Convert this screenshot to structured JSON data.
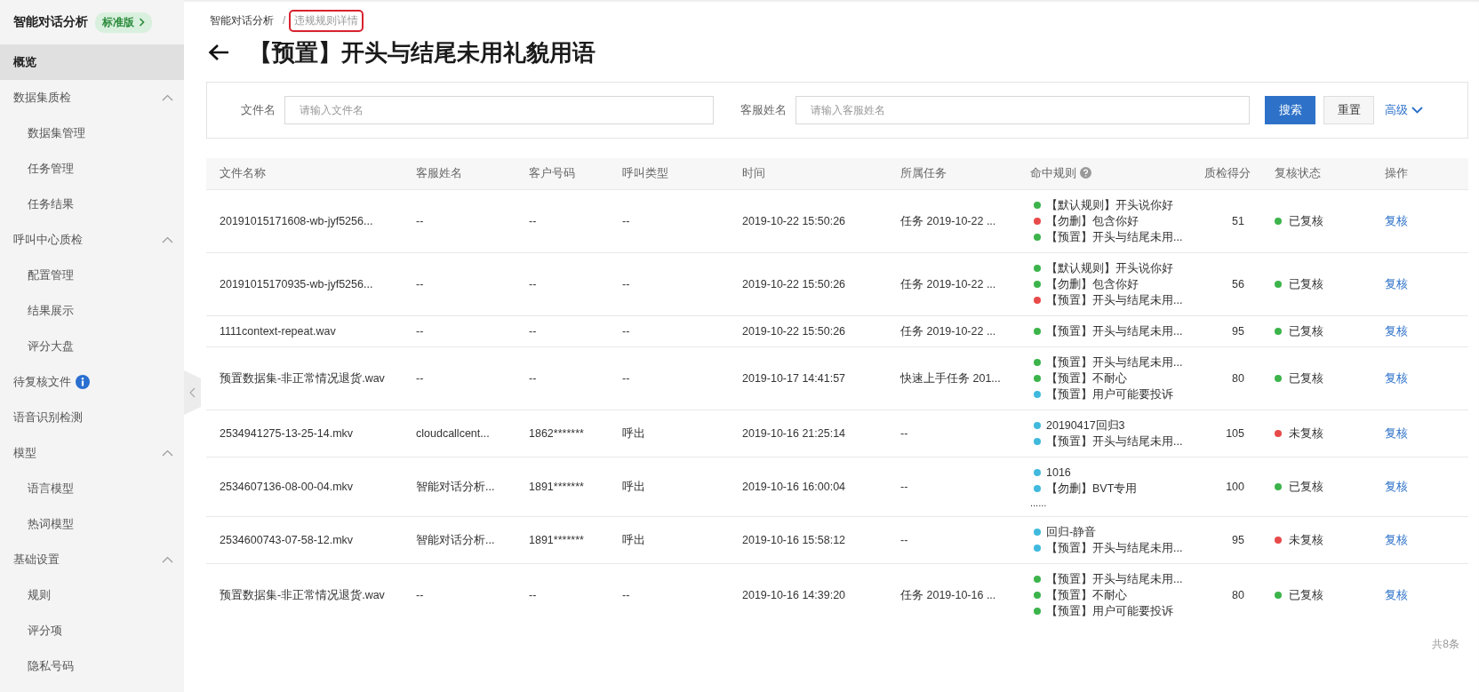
{
  "sidebar": {
    "brand": "智能对话分析",
    "edition": "标准版",
    "items": [
      {
        "label": "概览",
        "selected": true
      },
      {
        "label": "数据集质检",
        "selected": false,
        "expanded": true,
        "children": [
          {
            "label": "数据集管理",
            "selected": false
          },
          {
            "label": "任务管理",
            "selected": false
          },
          {
            "label": "任务结果",
            "selected": false
          }
        ]
      },
      {
        "label": "呼叫中心质检",
        "selected": false,
        "expanded": true,
        "children": [
          {
            "label": "配置管理",
            "selected": false
          },
          {
            "label": "结果展示",
            "selected": false
          },
          {
            "label": "评分大盘",
            "selected": false
          }
        ]
      },
      {
        "label": "待复核文件",
        "selected": false,
        "info_icon": true
      },
      {
        "label": "语音识别检测",
        "selected": false
      },
      {
        "label": "模型",
        "selected": false,
        "expanded": true,
        "children": [
          {
            "label": "语言模型",
            "selected": false
          },
          {
            "label": "热词模型",
            "selected": false
          }
        ]
      },
      {
        "label": "基础设置",
        "selected": false,
        "expanded": true,
        "children": [
          {
            "label": "规则",
            "selected": false
          },
          {
            "label": "评分项",
            "selected": false
          },
          {
            "label": "隐私号码",
            "selected": false
          }
        ]
      }
    ]
  },
  "breadcrumb": {
    "separator": "/",
    "items": [
      {
        "label": "智能对话分析",
        "current": false,
        "highlighted": false
      },
      {
        "label": "违规规则详情",
        "current": true,
        "highlighted": true
      }
    ]
  },
  "title": "【预置】开头与结尾未用礼貌用语",
  "filters": [
    {
      "label": "文件名",
      "placeholder": "请输入文件名"
    },
    {
      "label": "客服姓名",
      "placeholder": "请输入客服姓名"
    }
  ],
  "buttons": {
    "search": "搜索",
    "reset": "重置",
    "advanced": "高级"
  },
  "table": {
    "columns": [
      {
        "label": "文件名称"
      },
      {
        "label": "客服姓名"
      },
      {
        "label": "客户号码"
      },
      {
        "label": "呼叫类型"
      },
      {
        "label": "时间"
      },
      {
        "label": "所属任务"
      },
      {
        "label": "命中规则",
        "help_icon": true
      },
      {
        "label": "质检得分"
      },
      {
        "label": "复核状态"
      },
      {
        "label": "操作"
      }
    ],
    "rows": [
      {
        "file": "20191015171608-wb-jyf5256...",
        "agent": "--",
        "customer": "--",
        "call_type": "--",
        "time": "2019-10-22 15:50:26",
        "task": "任务 2019-10-22 ...",
        "rules": [
          {
            "text": "【默认规则】开头说你好",
            "color": "#3cb44b"
          },
          {
            "text": "【勿删】包含你好",
            "color": "#e84a4a"
          },
          {
            "text": "【预置】开头与结尾未用...",
            "color": "#3cb44b"
          }
        ],
        "score": "51",
        "status": {
          "text": "已复核",
          "color": "#3cb44b"
        },
        "action": "复核"
      },
      {
        "file": "20191015170935-wb-jyf5256...",
        "agent": "--",
        "customer": "--",
        "call_type": "--",
        "time": "2019-10-22 15:50:26",
        "task": "任务 2019-10-22 ...",
        "rules": [
          {
            "text": "【默认规则】开头说你好",
            "color": "#3cb44b"
          },
          {
            "text": "【勿删】包含你好",
            "color": "#3cb44b"
          },
          {
            "text": "【预置】开头与结尾未用...",
            "color": "#e84a4a"
          }
        ],
        "score": "56",
        "status": {
          "text": "已复核",
          "color": "#3cb44b"
        },
        "action": "复核"
      },
      {
        "file": "1111context-repeat.wav",
        "agent": "--",
        "customer": "--",
        "call_type": "--",
        "time": "2019-10-22 15:50:26",
        "task": "任务 2019-10-22 ...",
        "rules": [
          {
            "text": "【预置】开头与结尾未用...",
            "color": "#3cb44b"
          }
        ],
        "score": "95",
        "status": {
          "text": "已复核",
          "color": "#3cb44b"
        },
        "action": "复核"
      },
      {
        "file": "预置数据集-非正常情况退货.wav",
        "agent": "--",
        "customer": "--",
        "call_type": "--",
        "time": "2019-10-17 14:41:57",
        "task": "快速上手任务 201...",
        "rules": [
          {
            "text": "【预置】开头与结尾未用...",
            "color": "#3cb44b"
          },
          {
            "text": "【预置】不耐心",
            "color": "#3cb44b"
          },
          {
            "text": "【预置】用户可能要投诉",
            "color": "#40b9dd"
          }
        ],
        "score": "80",
        "status": {
          "text": "已复核",
          "color": "#3cb44b"
        },
        "action": "复核"
      },
      {
        "file": "2534941275-13-25-14.mkv",
        "agent": "cloudcallcent...",
        "customer": "1862*******",
        "call_type": "呼出",
        "time": "2019-10-16 21:25:14",
        "task": "--",
        "rules": [
          {
            "text": "20190417回归3",
            "color": "#40b9dd"
          },
          {
            "text": "【预置】开头与结尾未用...",
            "color": "#40b9dd"
          }
        ],
        "score": "105",
        "status": {
          "text": "未复核",
          "color": "#e84a4a"
        },
        "action": "复核"
      },
      {
        "file": "2534607136-08-00-04.mkv",
        "agent": "智能对话分析...",
        "customer": "1891*******",
        "call_type": "呼出",
        "time": "2019-10-16 16:00:04",
        "task": "--",
        "rules": [
          {
            "text": "1016",
            "color": "#40b9dd"
          },
          {
            "text": "【勿删】BVT专用",
            "color": "#40b9dd"
          }
        ],
        "more": "......",
        "score": "100",
        "status": {
          "text": "已复核",
          "color": "#3cb44b"
        },
        "action": "复核"
      },
      {
        "file": "2534600743-07-58-12.mkv",
        "agent": "智能对话分析...",
        "customer": "1891*******",
        "call_type": "呼出",
        "time": "2019-10-16 15:58:12",
        "task": "--",
        "rules": [
          {
            "text": "回归-静音",
            "color": "#40b9dd"
          },
          {
            "text": "【预置】开头与结尾未用...",
            "color": "#40b9dd"
          }
        ],
        "score": "95",
        "status": {
          "text": "未复核",
          "color": "#e84a4a"
        },
        "action": "复核"
      },
      {
        "file": "预置数据集-非正常情况退货.wav",
        "agent": "--",
        "customer": "--",
        "call_type": "--",
        "time": "2019-10-16 14:39:20",
        "task": "任务 2019-10-16 ...",
        "rules": [
          {
            "text": "【预置】开头与结尾未用...",
            "color": "#3cb44b"
          },
          {
            "text": "【预置】不耐心",
            "color": "#3cb44b"
          },
          {
            "text": "【预置】用户可能要投诉",
            "color": "#3cb44b"
          }
        ],
        "score": "80",
        "status": {
          "text": "已复核",
          "color": "#3cb44b"
        },
        "action": "复核"
      }
    ]
  },
  "total": "共8条"
}
